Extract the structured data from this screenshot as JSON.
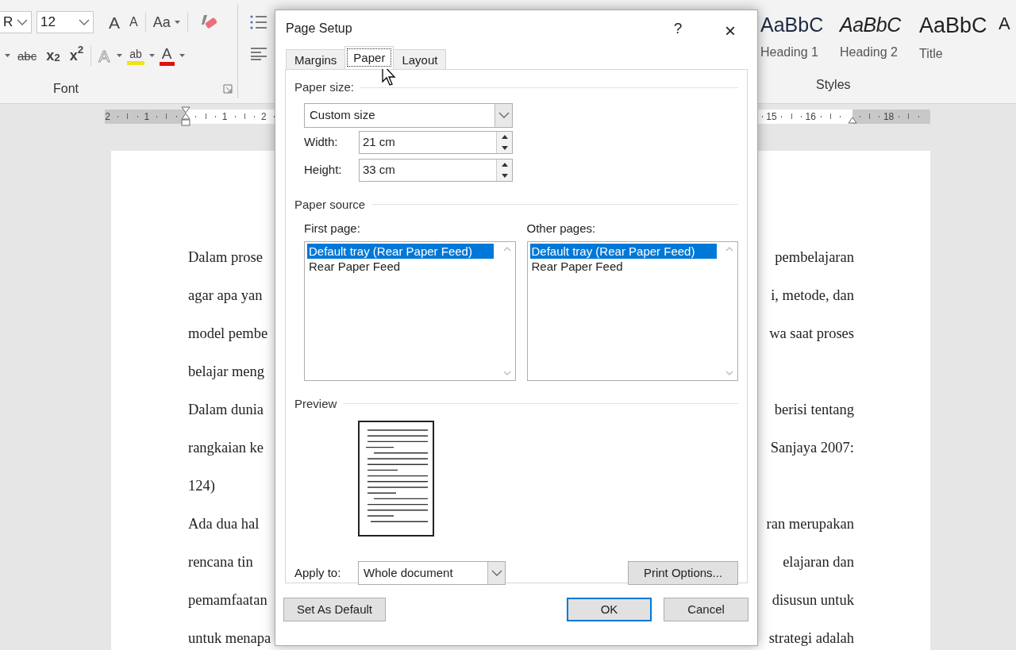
{
  "ribbon": {
    "font_group": {
      "font_name": "R",
      "font_size": "12",
      "grow_label": "A",
      "shrink_label": "A",
      "case_label": "Aa",
      "strike_label": "abc",
      "subscript_label": "x$_{2}$",
      "superscript_label": "x$^{2}$",
      "effects_label": "A",
      "highlight_label": "ab",
      "color_label": "A",
      "title": "Font"
    },
    "styles_group": {
      "title": "Styles",
      "items": [
        {
          "preview": "AaBbC",
          "name": "Heading 1",
          "kind": "heading1"
        },
        {
          "preview": "AaBbC",
          "name": "Heading 2",
          "kind": "heading2"
        },
        {
          "preview": "AaBbC",
          "name": "Title",
          "kind": "title"
        },
        {
          "preview": "A",
          "kind": "normal"
        }
      ]
    }
  },
  "ruler": {
    "labels": [
      "2",
      "1",
      "1",
      "2",
      "15",
      "16",
      "18"
    ]
  },
  "document": {
    "lines": [
      {
        "left": "Dalam prose",
        "right": "pembelajaran"
      },
      {
        "left": "agar apa yan",
        "right": "i, metode, dan"
      },
      {
        "left": "model pembe",
        "right": "wa saat proses"
      },
      {
        "left": "belajar meng"
      },
      {
        "left": "Dalam dunia",
        "right": "berisi tentang"
      },
      {
        "left": "rangkaian ke",
        "right": "Sanjaya 2007:"
      },
      {
        "left": "124)"
      },
      {
        "left": "Ada dua hal",
        "right": "ran merupakan"
      },
      {
        "left": "rencana tin",
        "right": "elajaran dan"
      },
      {
        "left": "pemamfaatan",
        "right": "disusun untuk"
      },
      {
        "left": "untuk menapa",
        "right": "strategi adalah"
      }
    ]
  },
  "dialog": {
    "title": "Page Setup",
    "help": "?",
    "close": "×",
    "tabs": [
      {
        "label": "Margins",
        "selected": false
      },
      {
        "label": "Paper",
        "selected": true
      },
      {
        "label": "Layout",
        "selected": false
      }
    ],
    "paper_size": {
      "heading": "Paper size:",
      "value": "Custom size",
      "width_label": "Width:",
      "width": "21 cm",
      "height_label": "Height:",
      "height": "33 cm"
    },
    "paper_source": {
      "heading": "Paper source",
      "lists": [
        {
          "label": "First page:",
          "items": [
            {
              "text": "Default tray (Rear Paper Feed)",
              "selected": true
            },
            {
              "text": "Rear Paper Feed",
              "selected": false
            }
          ]
        },
        {
          "label": "Other pages:",
          "items": [
            {
              "text": "Default tray (Rear Paper Feed)",
              "selected": true
            },
            {
              "text": "Rear Paper Feed",
              "selected": false
            }
          ]
        }
      ]
    },
    "preview": {
      "heading": "Preview"
    },
    "apply_to": {
      "label": "Apply to:",
      "value": "Whole document"
    },
    "print_options": "Print Options...",
    "buttons": [
      {
        "label": "Set As Default",
        "kind": "secondary"
      },
      {
        "label": "OK",
        "kind": "default"
      },
      {
        "label": "Cancel",
        "kind": "secondary"
      }
    ]
  }
}
